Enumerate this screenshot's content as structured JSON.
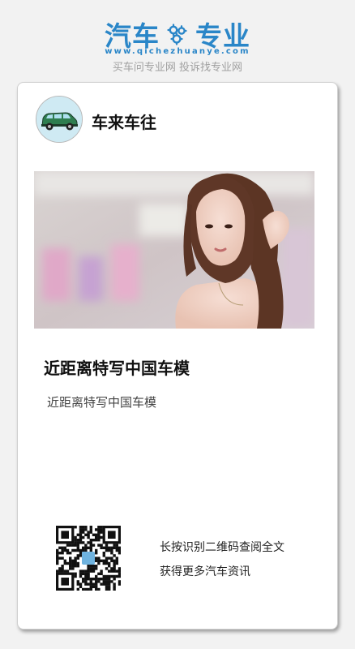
{
  "brand": {
    "name_left": "汽车",
    "name_right": "专业",
    "url": "www.qichezhuanye.com",
    "slogan": "买车问专业网 投诉找专业网",
    "color": "#2a86c8"
  },
  "card": {
    "author": "车来车往",
    "avatar_icon": "green-car-icon",
    "title": "近距离特写中国车模",
    "summary": "近距离特写中国车模",
    "qr": {
      "line1": "长按识别二维码查阅全文",
      "line2": "获得更多汽车资讯",
      "icon": "qr-code-icon"
    }
  }
}
